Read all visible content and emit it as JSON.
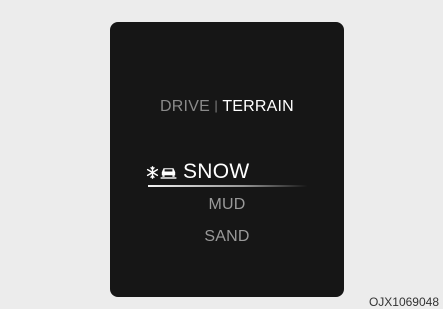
{
  "display": {
    "mode_header": {
      "drive_label": "DRIVE",
      "separator": "|",
      "terrain_label": "TERRAIN"
    },
    "terrain_modes": {
      "selected": {
        "label": "SNOW",
        "icons": [
          "snowflake-icon",
          "car-icon"
        ]
      },
      "options": [
        "MUD",
        "SAND"
      ]
    }
  },
  "reference_code": "OJX1069048",
  "colors": {
    "background": "#ececec",
    "panel": "#161616",
    "active_text": "#ffffff",
    "inactive_text": "#9a9a9a"
  }
}
